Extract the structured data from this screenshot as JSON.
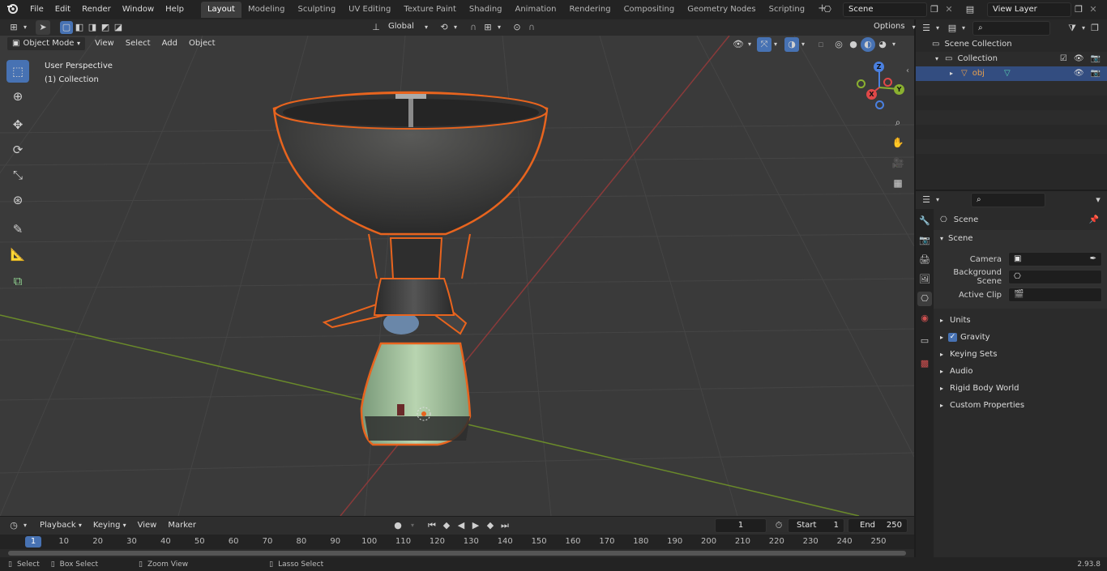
{
  "menus": [
    "File",
    "Edit",
    "Render",
    "Window",
    "Help"
  ],
  "workspaces": [
    "Layout",
    "Modeling",
    "Sculpting",
    "UV Editing",
    "Texture Paint",
    "Shading",
    "Animation",
    "Rendering",
    "Compositing",
    "Geometry Nodes",
    "Scripting"
  ],
  "active_workspace": "Layout",
  "scene_field": "Scene",
  "view_layer_field": "View Layer",
  "viewport": {
    "mode": "Object Mode",
    "menu": [
      "View",
      "Select",
      "Add",
      "Object"
    ],
    "transform_orientation": "Global",
    "options_label": "Options",
    "overlay_title": "User Perspective",
    "overlay_sub": "(1) Collection",
    "axis_x": "X",
    "axis_y": "Y",
    "axis_z": "Z"
  },
  "outliner": {
    "scene_collection": "Scene Collection",
    "collection": "Collection",
    "object": "obj"
  },
  "properties": {
    "header": "Scene",
    "section": "Scene",
    "camera_label": "Camera",
    "background_scene_label": "Background Scene",
    "active_clip_label": "Active Clip",
    "panels": [
      "Units",
      "Gravity",
      "Keying Sets",
      "Audio",
      "Rigid Body World",
      "Custom Properties"
    ]
  },
  "timeline": {
    "menu": [
      "Playback",
      "Keying",
      "View",
      "Marker"
    ],
    "current_frame": "1",
    "start_label": "Start",
    "start_value": "1",
    "end_label": "End",
    "end_value": "250",
    "ticks": [
      "1",
      "10",
      "20",
      "30",
      "40",
      "50",
      "60",
      "70",
      "80",
      "90",
      "100",
      "110",
      "120",
      "130",
      "140",
      "150",
      "160",
      "170",
      "180",
      "190",
      "200",
      "210",
      "220",
      "230",
      "240",
      "250"
    ]
  },
  "statusbar": {
    "select": "Select",
    "box_select": "Box Select",
    "zoom_view": "Zoom View",
    "lasso_select": "Lasso Select",
    "version": "2.93.8"
  },
  "colors": {
    "accent": "#4772b3",
    "selection_outline": "#e8641e",
    "grid_x_axis": "#8a3a3a",
    "grid_y_axis": "#6a8a2a"
  }
}
